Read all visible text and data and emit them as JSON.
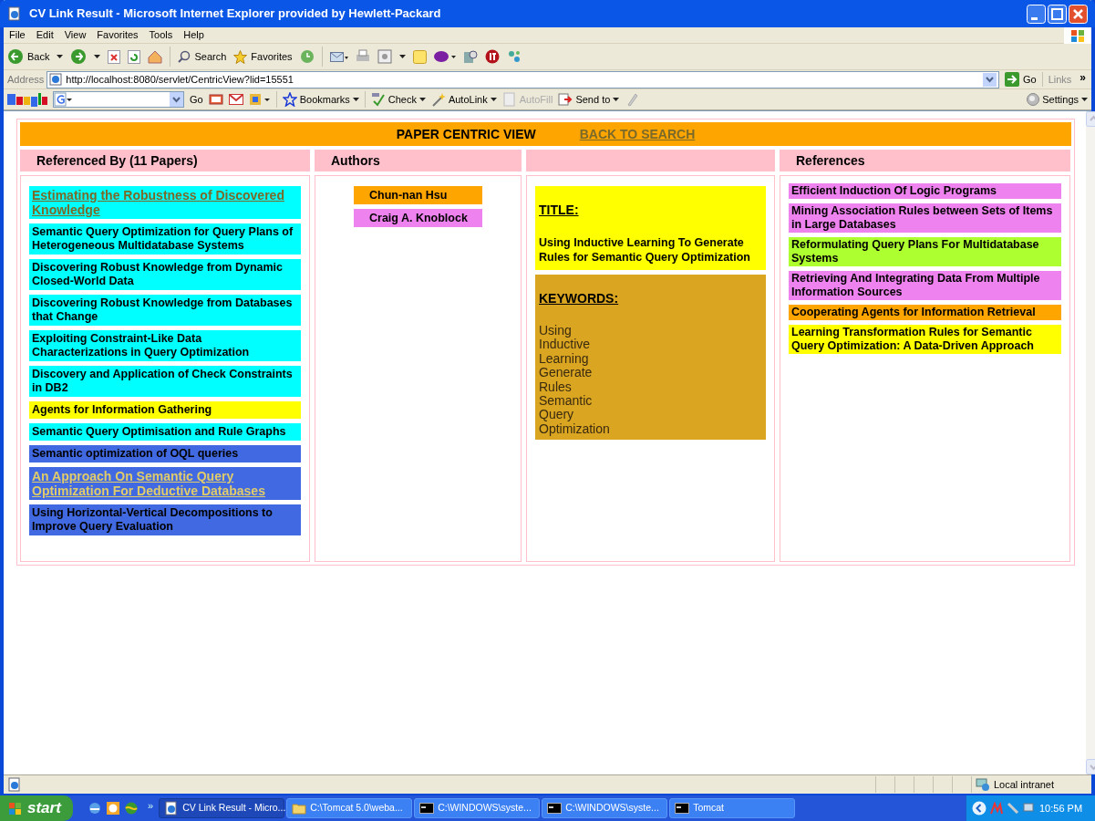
{
  "window": {
    "title": "CV Link Result - Microsoft Internet Explorer provided by Hewlett-Packard"
  },
  "menu": [
    "File",
    "Edit",
    "View",
    "Favorites",
    "Tools",
    "Help"
  ],
  "toolbar": {
    "back": "Back",
    "search": "Search",
    "favorites": "Favorites"
  },
  "address_bar": {
    "label": "Address",
    "value": "http://localhost:8080/servlet/CentricView?lid=15551",
    "go": "Go",
    "links": "Links",
    "more": "»"
  },
  "google_bar": {
    "go": "Go",
    "bookmarks": "Bookmarks",
    "check": "Check",
    "autolink": "AutoLink",
    "autofill": "AutoFill",
    "autofill_disabled": true,
    "send_to": "Send to",
    "settings": "Settings"
  },
  "page": {
    "heading": "PAPER CENTRIC VIEW",
    "back_link": "BACK TO SEARCH",
    "columns": [
      "Referenced By (11 Papers)",
      "Authors",
      "References"
    ],
    "referenced_by": [
      {
        "text": "Estimating the Robustness of Discovered Knowledge",
        "color": "#00ffff",
        "link": true
      },
      {
        "text": "Semantic Query Optimization for Query Plans of Heterogeneous Multidatabase Systems",
        "color": "#00ffff",
        "link": false
      },
      {
        "text": "Discovering Robust Knowledge from Dynamic Closed-World Data",
        "color": "#00ffff",
        "link": false
      },
      {
        "text": "Discovering Robust Knowledge from Databases that Change",
        "color": "#00ffff",
        "link": false
      },
      {
        "text": "Exploiting Constraint-Like Data Characterizations in Query Optimization",
        "color": "#00ffff",
        "link": false
      },
      {
        "text": "Discovery and Application of Check Constraints in DB2",
        "color": "#00ffff",
        "link": false
      },
      {
        "text": "Agents for Information Gathering",
        "color": "#ffff00",
        "link": false
      },
      {
        "text": "Semantic Query Optimisation and Rule Graphs",
        "color": "#00ffff",
        "link": false
      },
      {
        "text": "Semantic optimization of OQL queries",
        "color": "#4169e1",
        "link": false
      },
      {
        "text": "An Approach On Semantic Query Optimization For Deductive Databases",
        "color": "#4169e1",
        "link": true
      },
      {
        "text": "Using Horizontal-Vertical Decompositions to Improve Query Evaluation",
        "color": "#4169e1",
        "link": false
      }
    ],
    "authors": [
      {
        "name": "Chun-nan Hsu",
        "color": "#ffa500"
      },
      {
        "name": "Craig A. Knoblock",
        "color": "#ee82ee"
      }
    ],
    "title_label": "TITLE:",
    "title": "Using Inductive Learning To Generate Rules for Semantic Query Optimization",
    "keywords_label": "KEYWORDS:",
    "keywords": [
      "Using",
      "Inductive",
      "Learning",
      "Generate",
      "Rules",
      "Semantic",
      "Query",
      "Optimization"
    ],
    "references": [
      {
        "text": "Efficient Induction Of Logic Programs",
        "color": "#ee82ee"
      },
      {
        "text": "Mining Association Rules between Sets of Items in Large Databases",
        "color": "#ee82ee"
      },
      {
        "text": "Reformulating Query Plans For Multidatabase Systems",
        "color": "#adff2f"
      },
      {
        "text": "Retrieving And Integrating Data From Multiple Information Sources",
        "color": "#ee82ee"
      },
      {
        "text": "Cooperating Agents for Information Retrieval",
        "color": "#ffa500"
      },
      {
        "text": "Learning Transformation Rules for Semantic Query Optimization: A Data-Driven Approach",
        "color": "#ffff00"
      }
    ]
  },
  "status_bar": {
    "zone": "Local intranet"
  },
  "taskbar": {
    "start": "start",
    "tasks": [
      {
        "label": "CV Link Result - Micro...",
        "selected": true,
        "kind": "ie"
      },
      {
        "label": "C:\\Tomcat 5.0\\weba...",
        "selected": false,
        "kind": "folder"
      },
      {
        "label": "C:\\WINDOWS\\syste...",
        "selected": false,
        "kind": "console"
      },
      {
        "label": "C:\\WINDOWS\\syste...",
        "selected": false,
        "kind": "console"
      },
      {
        "label": "Tomcat",
        "selected": false,
        "kind": "console"
      }
    ],
    "more": "»",
    "clock": "10:56 PM"
  }
}
